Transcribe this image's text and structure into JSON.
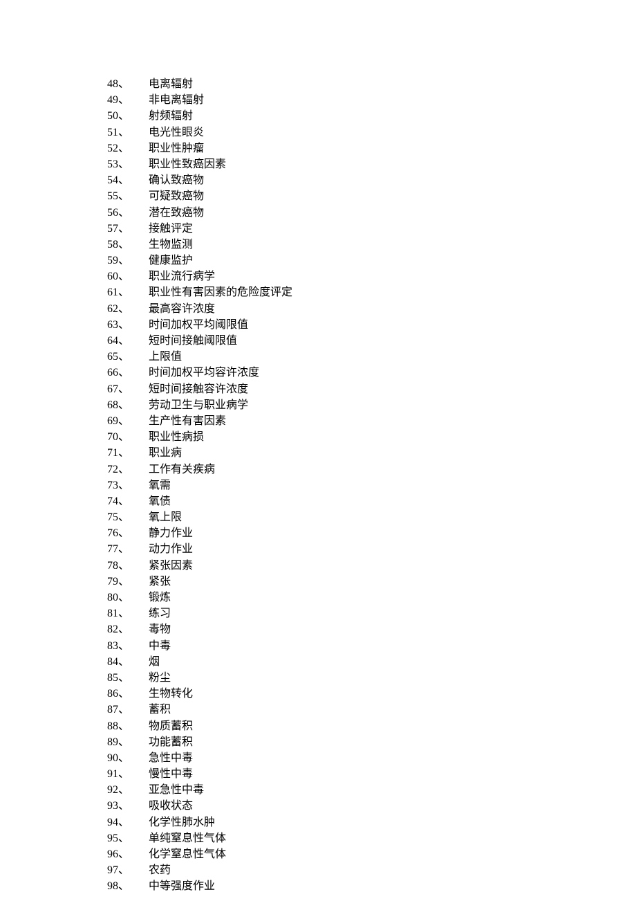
{
  "items": [
    {
      "num": "48、",
      "term": "电离辐射"
    },
    {
      "num": "49、",
      "term": "非电离辐射"
    },
    {
      "num": "50、",
      "term": "射频辐射"
    },
    {
      "num": "51、",
      "term": "电光性眼炎"
    },
    {
      "num": "52、",
      "term": "职业性肿瘤"
    },
    {
      "num": "53、",
      "term": "职业性致癌因素"
    },
    {
      "num": "54、",
      "term": "确认致癌物"
    },
    {
      "num": "55、",
      "term": "可疑致癌物"
    },
    {
      "num": "56、",
      "term": "潜在致癌物"
    },
    {
      "num": "57、",
      "term": "接触评定"
    },
    {
      "num": "58、",
      "term": "生物监测"
    },
    {
      "num": "59、",
      "term": "健康监护"
    },
    {
      "num": "60、",
      "term": "职业流行病学"
    },
    {
      "num": "61、",
      "term": "职业性有害因素的危险度评定"
    },
    {
      "num": "62、",
      "term": "最高容许浓度"
    },
    {
      "num": "63、",
      "term": "时间加权平均阈限值"
    },
    {
      "num": "64、",
      "term": "短时间接触阈限值"
    },
    {
      "num": "65、",
      "term": "上限值"
    },
    {
      "num": "66、",
      "term": "时间加权平均容许浓度"
    },
    {
      "num": "67、",
      "term": "短时间接触容许浓度"
    },
    {
      "num": "68、",
      "term": "劳动卫生与职业病学"
    },
    {
      "num": "69、",
      "term": "生产性有害因素"
    },
    {
      "num": "70、",
      "term": "职业性病损"
    },
    {
      "num": "71、",
      "term": "职业病"
    },
    {
      "num": "72、",
      "term": "工作有关疾病"
    },
    {
      "num": "73、",
      "term": "氧需"
    },
    {
      "num": "74、",
      "term": "氧债"
    },
    {
      "num": "75、",
      "term": "氧上限"
    },
    {
      "num": "76、",
      "term": "静力作业"
    },
    {
      "num": "77、",
      "term": "动力作业"
    },
    {
      "num": "78、",
      "term": "紧张因素"
    },
    {
      "num": "79、",
      "term": "紧张"
    },
    {
      "num": "80、",
      "term": "锻炼"
    },
    {
      "num": "81、",
      "term": "练习"
    },
    {
      "num": "82、",
      "term": "毒物"
    },
    {
      "num": "83、",
      "term": "中毒"
    },
    {
      "num": "84、",
      "term": "烟"
    },
    {
      "num": "85、",
      "term": "粉尘"
    },
    {
      "num": "86、",
      "term": "生物转化"
    },
    {
      "num": "87、",
      "term": "蓄积"
    },
    {
      "num": "88、",
      "term": "物质蓄积"
    },
    {
      "num": "89、",
      "term": "功能蓄积"
    },
    {
      "num": "90、",
      "term": "急性中毒"
    },
    {
      "num": "91、",
      "term": "慢性中毒"
    },
    {
      "num": "92、",
      "term": "亚急性中毒"
    },
    {
      "num": "93、",
      "term": "吸收状态"
    },
    {
      "num": "94、",
      "term": "化学性肺水肿"
    },
    {
      "num": "95、",
      "term": "单纯窒息性气体"
    },
    {
      "num": "96、",
      "term": "化学窒息性气体"
    },
    {
      "num": "97、",
      "term": "农药"
    },
    {
      "num": "98、",
      "term": "中等强度作业"
    }
  ]
}
